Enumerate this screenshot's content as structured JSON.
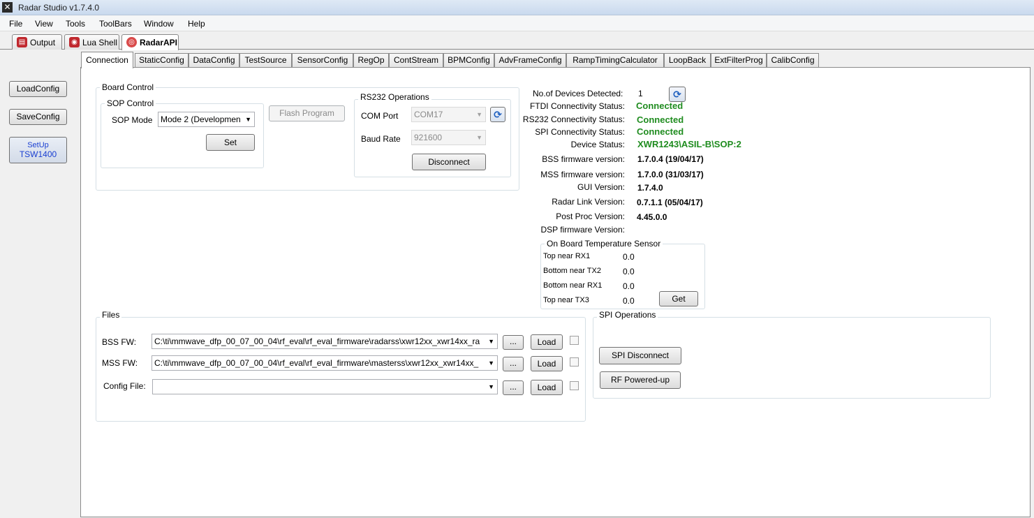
{
  "window": {
    "title": "Radar Studio v1.7.4.0"
  },
  "menu": [
    "File",
    "View",
    "Tools",
    "ToolBars",
    "Window",
    "Help"
  ],
  "doc_tabs": [
    {
      "label": "Output",
      "icon": "output-icon"
    },
    {
      "label": "Lua Shell",
      "icon": "lua-shell-icon"
    },
    {
      "label": "RadarAPI",
      "icon": "radar-api-icon",
      "active": true
    }
  ],
  "left_panel": {
    "load_config": "LoadConfig",
    "save_config": "SaveConfig",
    "setup_line1": "SetUp",
    "setup_line2": "TSW1400"
  },
  "inner_tabs": [
    "Connection",
    "StaticConfig",
    "DataConfig",
    "TestSource",
    "SensorConfig",
    "RegOp",
    "ContStream",
    "BPMConfig",
    "AdvFrameConfig",
    "RampTimingCalculator",
    "LoopBack",
    "ExtFilterProg",
    "CalibConfig"
  ],
  "board_control": {
    "title": "Board Control",
    "sop_control": {
      "title": "SOP Control",
      "mode_label": "SOP Mode",
      "mode_value": "Mode 2 (Developmen",
      "set_button": "Set"
    },
    "flash_program": "Flash Program",
    "rs232": {
      "title": "RS232 Operations",
      "com_port_label": "COM Port",
      "com_port_value": "COM17",
      "baud_rate_label": "Baud Rate",
      "baud_rate_value": "921600",
      "disconnect_button": "Disconnect"
    }
  },
  "status": {
    "devices_label": "No.of Devices Detected:",
    "devices_value": "1",
    "ftdi_label": "FTDI Connectivity Status:",
    "ftdi_value": "Connected",
    "rs232_label": "RS232 Connectivity Status:",
    "rs232_value": "Connected",
    "spi_label": "SPI Connectivity Status:",
    "spi_value": "Connected",
    "device_label": "Device Status:",
    "device_value": "XWR1243\\ASIL-B\\SOP:2",
    "bss_fw_label": "BSS firmware version:",
    "bss_fw_value": "1.7.0.4 (19/04/17)",
    "mss_fw_label": "MSS firmware version:",
    "mss_fw_value": "1.7.0.0 (31/03/17)",
    "gui_label": "GUI Version:",
    "gui_value": "1.7.4.0",
    "radar_link_label": "Radar Link Version:",
    "radar_link_value": "0.7.1.1 (05/04/17)",
    "post_proc_label": "Post Proc Version:",
    "post_proc_value": "4.45.0.0",
    "dsp_fw_label": "DSP firmware Version:",
    "dsp_fw_value": ""
  },
  "temperature": {
    "title": "On Board Temperature Sensor",
    "rows": [
      {
        "label": "Top near RX1",
        "value": "0.0"
      },
      {
        "label": "Bottom near TX2",
        "value": "0.0"
      },
      {
        "label": "Bottom near RX1",
        "value": "0.0"
      },
      {
        "label": "Top near TX3",
        "value": "0.0"
      }
    ],
    "get_button": "Get"
  },
  "files": {
    "title": "Files",
    "rows": [
      {
        "label": "BSS FW:",
        "path": "C:\\ti\\mmwave_dfp_00_07_00_04\\rf_eval\\rf_eval_firmware\\radarss\\xwr12xx_xwr14xx_ra",
        "browse": "...",
        "load": "Load"
      },
      {
        "label": "MSS FW:",
        "path": "C:\\ti\\mmwave_dfp_00_07_00_04\\rf_eval\\rf_eval_firmware\\masterss\\xwr12xx_xwr14xx_",
        "browse": "...",
        "load": "Load"
      },
      {
        "label": "Config File:",
        "path": "",
        "browse": "...",
        "load": "Load"
      }
    ]
  },
  "spi_ops": {
    "title": "SPI Operations",
    "spi_disconnect": "SPI Disconnect",
    "rf_powered_up": "RF Powered-up"
  },
  "colors": {
    "connected_green": "#1f8c1f",
    "setup_blue": "#1a3fd1"
  }
}
